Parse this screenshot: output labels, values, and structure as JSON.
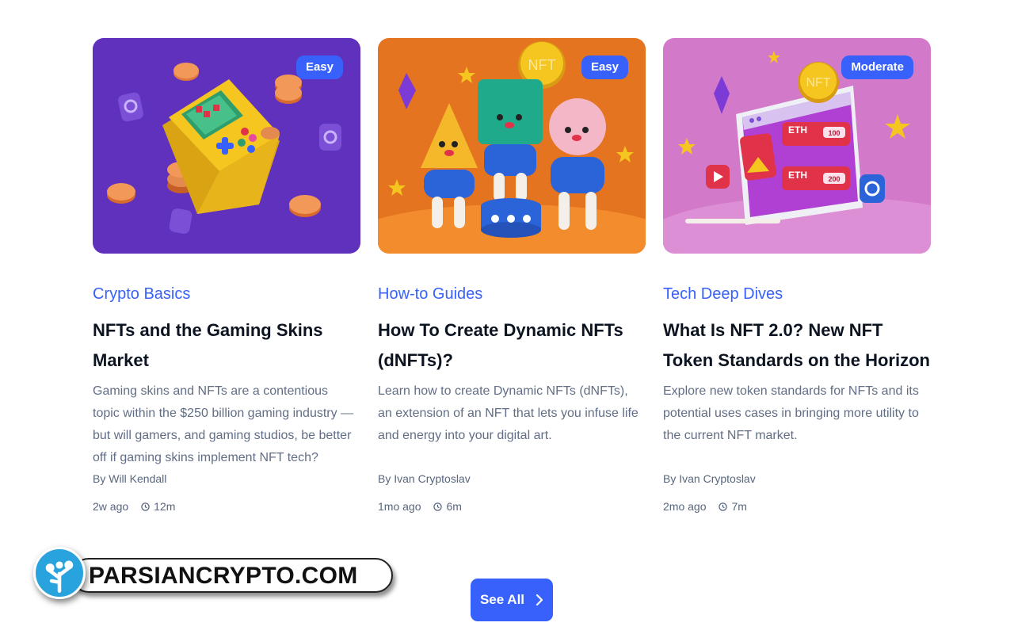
{
  "cards": [
    {
      "badge": "Easy",
      "category": "Crypto Basics",
      "title": "NFTs and the Gaming Skins Market",
      "description": "Gaming skins and NFTs are a contentious topic within the $250 billion gaming industry — but will gamers, and gaming studios, be better off if gaming skins implement NFT tech?",
      "author": "By Will Kendall",
      "age": "2w ago",
      "read_time": "12m",
      "image_icon": "gameboy-illustration"
    },
    {
      "badge": "Easy",
      "category": "How-to Guides",
      "title": "How To Create Dynamic NFTs (dNFTs)?",
      "description": "Learn how to create Dynamic NFTs (dNFTs), an extension of an NFT that lets you infuse life and energy into your digital art.",
      "author": "By Ivan Cryptoslav",
      "age": "1mo ago",
      "read_time": "6m",
      "image_icon": "nft-characters-illustration",
      "image_label": "NFT"
    },
    {
      "badge": "Moderate",
      "category": "Tech Deep Dives",
      "title": "What Is NFT 2.0? New NFT Token Standards on the Horizon",
      "description": "Explore new token standards for NFTs and its potential uses cases in bringing more utility to the current NFT market.",
      "author": "By Ivan Cryptoslav",
      "age": "2mo ago",
      "read_time": "7m",
      "image_icon": "nft-tablet-illustration",
      "image_label": "NFT",
      "image_rows": [
        {
          "label": "ETH",
          "value": "100"
        },
        {
          "label": "ETH",
          "value": "200"
        }
      ]
    }
  ],
  "see_all": {
    "label": "See All"
  },
  "watermark": {
    "text": "PARSIANCRYPTO.COM"
  },
  "colors": {
    "accent": "#3861fb",
    "text": "#0d1421",
    "muted": "#616e85"
  }
}
